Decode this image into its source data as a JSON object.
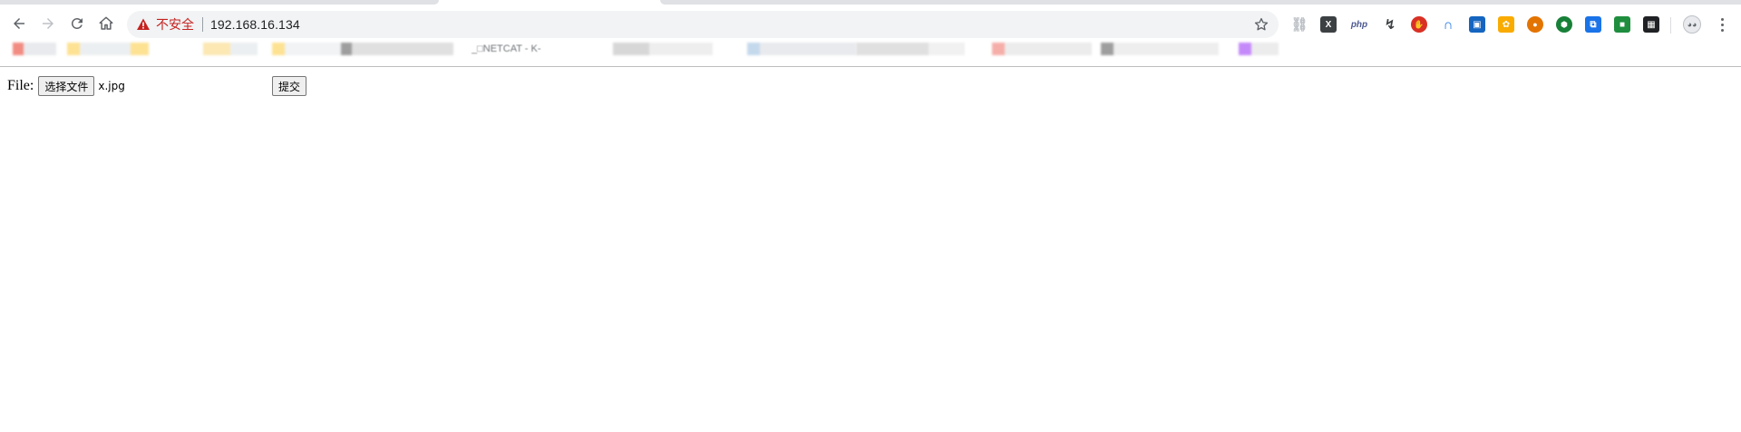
{
  "browser": {
    "security_label": "不安全",
    "url": "192.168.16.134",
    "colors": {
      "warning": "#c5221f",
      "omnibox_bg": "#f1f3f4",
      "icon": "#5f6368"
    },
    "extensions": [
      {
        "icon": "link-icon",
        "color": "#bdc1c6",
        "glyph": "⛓"
      },
      {
        "icon": "x-icon",
        "color": "#3c4043",
        "glyph": "X"
      },
      {
        "icon": "php-icon",
        "color": "#4f5b93",
        "glyph": "php"
      },
      {
        "icon": "graph-icon",
        "color": "#3c4043",
        "glyph": "↯"
      },
      {
        "icon": "hand-icon",
        "color": "#d93025",
        "glyph": "✋"
      },
      {
        "icon": "arch-icon",
        "color": "#1a73e8",
        "glyph": "∩"
      },
      {
        "icon": "translate-icon",
        "color": "#1565c0",
        "glyph": "▣"
      },
      {
        "icon": "wheel-icon",
        "color": "#f9ab00",
        "glyph": "✿"
      },
      {
        "icon": "cookie-icon",
        "color": "#e37400",
        "glyph": "●"
      },
      {
        "icon": "shield-icon",
        "color": "#188038",
        "glyph": "⬢"
      },
      {
        "icon": "screen-icon",
        "color": "#1a73e8",
        "glyph": "⧉"
      },
      {
        "icon": "green-square-icon",
        "color": "#1e8e3e",
        "glyph": "■"
      },
      {
        "icon": "dark-square-icon",
        "color": "#202124",
        "glyph": "▦"
      }
    ]
  },
  "bookmarks": {
    "visible_fragment": "_□NETCAT - K-"
  },
  "form": {
    "label": "File:",
    "choose_button": "选择文件",
    "selected_file": "x.jpg",
    "submit_button": "提交"
  }
}
